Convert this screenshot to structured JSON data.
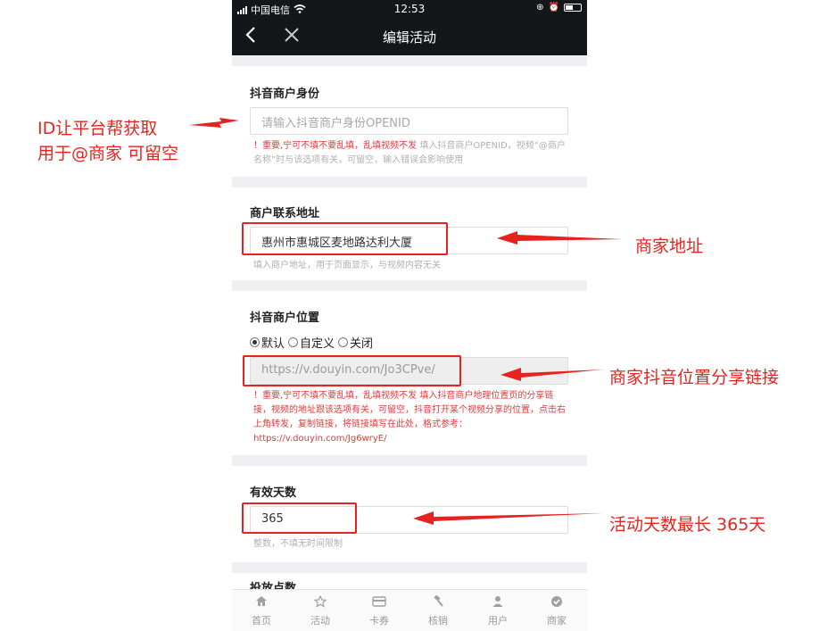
{
  "status_bar": {
    "carrier": "中国电信",
    "time": "12:53"
  },
  "nav": {
    "title": "编辑活动"
  },
  "sections": {
    "openid": {
      "label": "抖音商户身份",
      "placeholder": "请输入抖音商户身份OPENID",
      "hint_red": "！重要,宁可不填不要乱填，乱填视频不发",
      "hint_gray": " 填入抖音商户OPENID，视频“@商户名称”时与该选项有关，可留空，输入错误会影响使用"
    },
    "address": {
      "label": "商户联系地址",
      "value": "惠州市惠城区麦地路达利大厦",
      "hint": "填入商户地址，用于页面显示，与视频内容无关"
    },
    "location": {
      "label": "抖音商户位置",
      "options": [
        "默认",
        "自定义",
        "关闭"
      ],
      "selected": "默认",
      "value": "https://v.douyin.com/Jo3CPve/",
      "hint": "！重要,宁可不填不要乱填，乱填视频不发 填入抖音商户地理位置页的分享链接，视频的地址跟该选项有关，可留空，抖音打开某个视频分享的位置，点击右上角转发，复制链接，将链接填写在此处，格式参考：https://v.douyin.com/Jg6wryE/"
    },
    "days": {
      "label": "有效天数",
      "value": "365",
      "hint": "整数，不填无时间限制"
    },
    "next": {
      "label": "投放点数"
    }
  },
  "tabbar": [
    {
      "label": "首页",
      "icon": "home-icon"
    },
    {
      "label": "活动",
      "icon": "star-icon"
    },
    {
      "label": "卡券",
      "icon": "card-icon"
    },
    {
      "label": "核销",
      "icon": "gavel-icon"
    },
    {
      "label": "用户",
      "icon": "user-icon"
    },
    {
      "label": "商家",
      "icon": "check-circle-icon"
    }
  ],
  "annotations": {
    "openid_line1": "ID让平台帮获取",
    "openid_line2": "用于@商家 可留空",
    "address": "商家地址",
    "location": "商家抖音位置分享链接",
    "days": "活动天数最长 365天"
  },
  "colors": {
    "annotation_red": "#e8231f",
    "nav_bg": "#15161a",
    "hint_red": "#e23a3a"
  }
}
